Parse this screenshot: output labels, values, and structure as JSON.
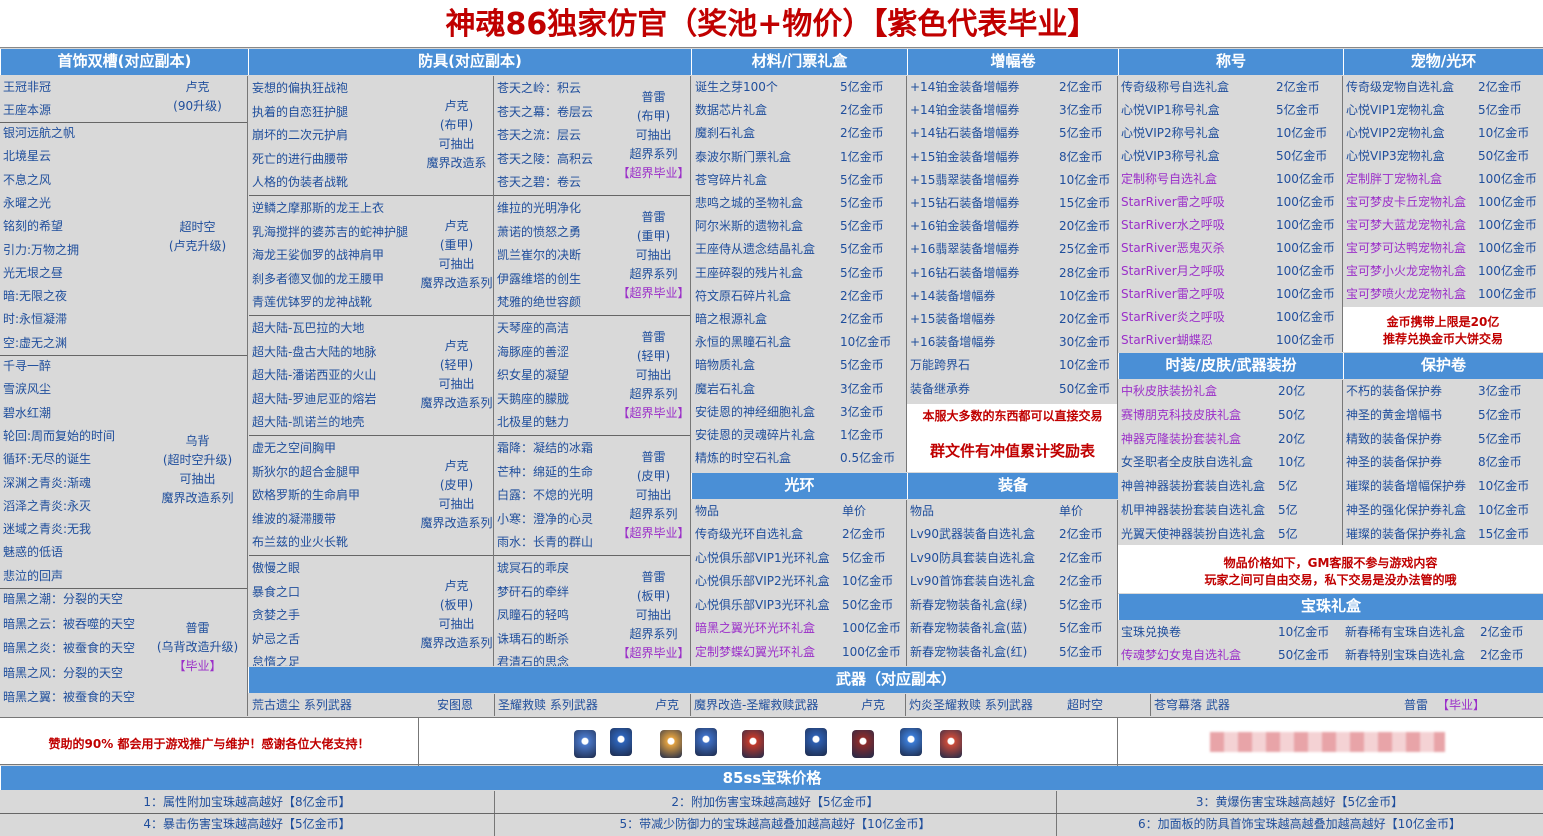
{
  "title": "神魂86独家仿官（奖池+物价）【紫色代表毕业】",
  "headers": {
    "accessory": "首饰双槽(对应副本)",
    "armor": "防具(对应副本)",
    "material": "材料/门票礼盒",
    "amplify": "增幅卷",
    "title_col": "称号",
    "pet": "宠物/光环",
    "fashion": "时装/皮肤/武器装扮",
    "protect": "保护卷",
    "aura": "光环",
    "equip": "装备",
    "gem_box": "宝珠礼盒",
    "weapon": "武器（对应副本）",
    "gem85": "85ss宝珠价格"
  },
  "accessory": {
    "g1": {
      "items": [
        "王冠非冠",
        "王座本源"
      ],
      "note": [
        "卢克",
        "(90升级)"
      ]
    },
    "g2": {
      "items": [
        "银河远航之帆",
        "北境星云",
        "不息之风",
        "永曜之光",
        "铭刻的希望",
        "引力:万物之拥",
        "光无垠之昼",
        "暗:无限之夜",
        "时:永恒凝滞",
        "空:虚无之渊"
      ],
      "note": [
        "超时空",
        "(卢克升级)"
      ]
    },
    "g3": {
      "items": [
        "千寻一醉",
        "雪涙风尘",
        "碧水红潮",
        "轮回:周而复始的时间",
        "循环:无尽的诞生",
        "深渊之青炎:渐魂",
        "滔泽之青炎:永灭",
        "迷域之青炎:无我",
        "魅惑的低语",
        "悲泣的回声"
      ],
      "note": [
        "乌背",
        "(超时空升级)",
        "可抽出",
        "魔界改造系列"
      ]
    },
    "g4": {
      "items": [
        "暗黑之潮：分裂的天空",
        "暗黑之云：被吞噬的天空",
        "暗黑之炎：被蚕食的天空",
        "暗黑之风：分裂的天空",
        "暗黑之翼：被蚕食的天空"
      ],
      "note": [
        "普雷",
        "(乌背改造升级)",
        "【毕业】"
      ]
    }
  },
  "armor_left": [
    {
      "items": [
        "妄想的偏执狂战袍",
        "执着的自恋狂护腿",
        "崩坏的二次元护肩",
        "死亡的进行曲腰带",
        "人格的伪装者战靴"
      ],
      "note": [
        "卢克",
        "(布甲)",
        "可抽出",
        "魔界改造系"
      ]
    },
    {
      "items": [
        "逆鳞之摩那斯的龙王上衣",
        "乳海搅拌的婆苏吉的蛇神护腿",
        "海龙王娑伽罗的战神肩甲",
        "刹多者德叉伽的龙王腰甲",
        "青莲优钵罗的龙神战靴"
      ],
      "note": [
        "卢克",
        "(重甲)",
        "可抽出",
        "魔界改造系列"
      ]
    },
    {
      "items": [
        "超大陆-瓦巴拉的大地",
        "超大陆-盘古大陆的地脉",
        "超大陆-潘诺西亚的火山",
        "超大陆-罗迪尼亚的熔岩",
        "超大陆-凯诺兰的地壳"
      ],
      "note": [
        "卢克",
        "(轻甲)",
        "可抽出",
        "魔界改造系列"
      ]
    },
    {
      "items": [
        "虚无之空间胸甲",
        "斯狄尔的超合金腿甲",
        "欧格罗斯的生命肩甲",
        "维波的凝滞腰带",
        "布兰兹的业火长靴"
      ],
      "note": [
        "卢克",
        "(皮甲)",
        "可抽出",
        "魔界改造系列"
      ]
    },
    {
      "items": [
        "傲慢之眼",
        "暴食之口",
        "贪婪之手",
        "妒忌之舌",
        "怠惰之足"
      ],
      "note": [
        "卢克",
        "(板甲)",
        "可抽出",
        "魔界改造系列"
      ]
    }
  ],
  "armor_right": [
    {
      "items": [
        "苍天之岭：积云",
        "苍天之幕：卷层云",
        "苍天之流：层云",
        "苍天之陵：高积云",
        "苍天之碧：卷云"
      ],
      "note": [
        "普雷",
        "(布甲)",
        "可抽出",
        "超界系列",
        "【超界毕业】"
      ]
    },
    {
      "items": [
        "维拉的光明净化",
        "萧诺的愤怒之勇",
        "凯兰崔尔的决断",
        "伊露维塔的创生",
        "梵雅的绝世容颜"
      ],
      "note": [
        "普雷",
        "(重甲)",
        "可抽出",
        "超界系列",
        "【超界毕业】"
      ]
    },
    {
      "items": [
        "天琴座的高洁",
        "海豚座的善涩",
        "织女星的凝望",
        "天鹅座的朦胧",
        "北极星的魅力"
      ],
      "note": [
        "普雷",
        "(轻甲)",
        "可抽出",
        "超界系列",
        "【超界毕业】"
      ]
    },
    {
      "items": [
        "霜降：凝结的冰霜",
        "芒种：绵延的生命",
        "白露：不熄的光明",
        "小寒：澄净的心灵",
        "雨水：长青的群山"
      ],
      "note": [
        "普雷",
        "(皮甲)",
        "可抽出",
        "超界系列",
        "【超界毕业】"
      ]
    },
    {
      "items": [
        "琥冥石的乖戾",
        "梦矸石的牵绊",
        "凤瞳石的轻鸣",
        "诛瑀石的断杀",
        "君清石的思念"
      ],
      "note": [
        "普雷",
        "(板甲)",
        "可抽出",
        "超界系列",
        "【超界毕业】"
      ]
    }
  ],
  "material": [
    [
      "诞生之芽100个",
      "5亿金币"
    ],
    [
      "数据芯片礼盒",
      "2亿金币"
    ],
    [
      "魔刹石礼盒",
      "2亿金币"
    ],
    [
      "泰波尔斯门票礼盒",
      "1亿金币"
    ],
    [
      "苍穹碎片礼盒",
      "5亿金币"
    ],
    [
      "悲鸣之城的圣物礼盒",
      "5亿金币"
    ],
    [
      "阿尔米斯的遗物礼盒",
      "5亿金币"
    ],
    [
      "王座侍从遗念结晶礼盒",
      "5亿金币"
    ],
    [
      "王座碎裂的残片礼盒",
      "5亿金币"
    ],
    [
      "符文原石碎片礼盒",
      "2亿金币"
    ],
    [
      "暗之根源礼盒",
      "2亿金币"
    ],
    [
      "永恒的黑瞳石礼盒",
      "10亿金币"
    ],
    [
      "暗物质礼盒",
      "5亿金币"
    ],
    [
      "魔岩石礼盒",
      "3亿金币"
    ],
    [
      "安徒恩的神经细胞礼盒",
      "3亿金币"
    ],
    [
      "安徒恩的灵魂碎片礼盒",
      "1亿金币"
    ],
    [
      "精炼的时空石礼盒",
      "0.5亿金币"
    ]
  ],
  "amplify": [
    [
      "+14铂金装备增幅券",
      "2亿金币"
    ],
    [
      "+14铂金装备增幅券",
      "3亿金币"
    ],
    [
      "+14钻石装备增幅券",
      "5亿金币"
    ],
    [
      "+15铂金装备增幅券",
      "8亿金币"
    ],
    [
      "+15翡翠装备增幅券",
      "10亿金币"
    ],
    [
      "+15钻石装备增幅券",
      "15亿金币"
    ],
    [
      "+16铂金装备增幅券",
      "20亿金币"
    ],
    [
      "+16翡翠装备增幅券",
      "25亿金币"
    ],
    [
      "+16钻石装备增幅券",
      "28亿金币"
    ],
    [
      "+14装备增幅券",
      "10亿金币"
    ],
    [
      "+15装备增幅券",
      "20亿金币"
    ],
    [
      "+16装备增幅券",
      "30亿金币"
    ],
    [
      "万能跨界石",
      "10亿金币"
    ],
    [
      "装备继承券",
      "50亿金币"
    ]
  ],
  "amplify_note": "本服大多数的东西都可以直接交易",
  "group_note": "群文件有冲值累计奖励表",
  "titles": [
    [
      "传奇级称号自选礼盒",
      "2亿金币",
      ""
    ],
    [
      "心悦VIP1称号礼盒",
      "5亿金币",
      ""
    ],
    [
      "心悦VIP2称号礼盒",
      "10亿金币",
      ""
    ],
    [
      "心悦VIP3称号礼盒",
      "50亿金币",
      ""
    ],
    [
      "定制称号自选礼盒",
      "100亿金币",
      "p"
    ],
    [
      "StarRiver雷之呼吸",
      "100亿金币",
      "p"
    ],
    [
      "StarRiver水之呼吸",
      "100亿金币",
      "p"
    ],
    [
      "StarRiver恶鬼灭杀",
      "100亿金币",
      "p"
    ],
    [
      "StarRiver月之呼吸",
      "100亿金币",
      "p"
    ],
    [
      "StarRiver雷之呼吸",
      "100亿金币",
      "p"
    ],
    [
      "StarRiver炎之呼吸",
      "100亿金币",
      "p"
    ],
    [
      "StarRiver蝴蝶忍",
      "100亿金币",
      "p"
    ]
  ],
  "pets": [
    [
      "传奇级宠物自选礼盒",
      "2亿金币",
      ""
    ],
    [
      "心悦VIP1宠物礼盒",
      "5亿金币",
      ""
    ],
    [
      "心悦VIP2宠物礼盒",
      "10亿金币",
      ""
    ],
    [
      "心悦VIP3宠物礼盒",
      "50亿金币",
      ""
    ],
    [
      "定制胖丁宠物礼盒",
      "100亿金币",
      "p"
    ],
    [
      "宝可梦皮卡丘宠物礼盒",
      "100亿金币",
      "p"
    ],
    [
      "宝可梦大蓝龙宠物礼盒",
      "100亿金币",
      "p"
    ],
    [
      "宝可梦可达鸭宠物礼盒",
      "100亿金币",
      "p"
    ],
    [
      "宝可梦小火龙宠物礼盒",
      "100亿金币",
      "p"
    ],
    [
      "宝可梦喷火龙宠物礼盒",
      "100亿金币",
      "p"
    ]
  ],
  "pet_note": [
    "金币携带上限是20亿",
    "推荐兑换金币大饼交易"
  ],
  "fashion": [
    [
      "中秋皮肤装扮礼盒",
      "20亿",
      "p"
    ],
    [
      "赛博朋克科技皮肤礼盒",
      "50亿",
      "p"
    ],
    [
      "神器克隆装扮套装礼盒",
      "20亿",
      "p"
    ],
    [
      "女圣职者全皮肤自选礼盒",
      "10亿",
      ""
    ],
    [
      "神兽神器装扮套装自选礼盒",
      "5亿",
      ""
    ],
    [
      "机甲神器装扮套装自选礼盒",
      "5亿",
      ""
    ],
    [
      "光翼天使神器装扮自选礼盒",
      "5亿",
      ""
    ]
  ],
  "protect": [
    [
      "不朽的装备保护券",
      "3亿金币"
    ],
    [
      "神圣的黄金增幅书",
      "5亿金币"
    ],
    [
      "精致的装备保护券",
      "5亿金币"
    ],
    [
      "神圣的装备保护券",
      "8亿金币"
    ],
    [
      "璀璨的装备增幅保护券",
      "10亿金币"
    ],
    [
      "神圣的强化保护券礼盒",
      "10亿金币"
    ],
    [
      "璀璨的装备保护券礼盒",
      "15亿金币"
    ]
  ],
  "aura": {
    "head": [
      "物品",
      "单价"
    ],
    "rows": [
      [
        "传奇级光环自选礼盒",
        "2亿金币",
        ""
      ],
      [
        "心悦俱乐部VIP1光环礼盒",
        "5亿金币",
        ""
      ],
      [
        "心悦俱乐部VIP2光环礼盒",
        "10亿金币",
        ""
      ],
      [
        "心悦俱乐部VIP3光环礼盒",
        "50亿金币",
        ""
      ],
      [
        "暗黑之翼光环光环礼盒",
        "100亿金币",
        "p"
      ],
      [
        "定制梦蝶幻翼光环礼盒",
        "100亿金币",
        "p"
      ]
    ]
  },
  "equip": {
    "head": [
      "物品",
      "单价"
    ],
    "rows": [
      [
        "Lv90武器装备自选礼盒",
        "2亿金币"
      ],
      [
        "Lv90防具套装自选礼盒",
        "2亿金币"
      ],
      [
        "Lv90首饰套装自选礼盒",
        "2亿金币"
      ],
      [
        "新春宠物装备礼盒(绿)",
        "5亿金币"
      ],
      [
        "新春宠物装备礼盒(蓝)",
        "5亿金币"
      ],
      [
        "新春宠物装备礼盒(红)",
        "5亿金币"
      ]
    ]
  },
  "price_note": [
    "物品价格如下，GM客服不参与游戏内容",
    "玩家之间可自由交易，私下交易是没办法管的哦"
  ],
  "gem_box": [
    [
      "宝珠兑换卷",
      "10亿金币",
      "新春稀有宝珠自选礼盒",
      "2亿金币",
      ""
    ],
    [
      "传魂梦幻女鬼自选礼盒",
      "50亿金币",
      "新春特别宝珠自选礼盒",
      "2亿金币",
      "p"
    ]
  ],
  "weapons": [
    [
      "荒古遗尘 系列武器",
      "安图恩"
    ],
    [
      "圣耀救赎 系列武器",
      "卢克"
    ],
    [
      "魔界改造-圣耀救赎武器",
      "卢克"
    ],
    [
      "灼炎圣耀救赎 系列武器",
      "超时空"
    ],
    [
      "苍穹幕落 武器",
      "普雷",
      "【毕业】"
    ]
  ],
  "sponsor": "赞助的90% 都会用于游戏推广与维护！感谢各位大佬支持！",
  "gems": [
    [
      "1：属性附加宝珠越高越好【8亿金币】",
      "2：附加伤害宝珠越高越好【5亿金币】",
      "3：黄爆伤害宝珠越高越好【5亿金币】"
    ],
    [
      "4：暴击伤害宝珠越高越好【5亿金币】",
      "5：带减少防御力的宝珠越高越叠加越高越好【10亿金币】",
      "6：加面板的防具首饰宝珠越高越叠加越高越好【10亿金币】"
    ]
  ]
}
